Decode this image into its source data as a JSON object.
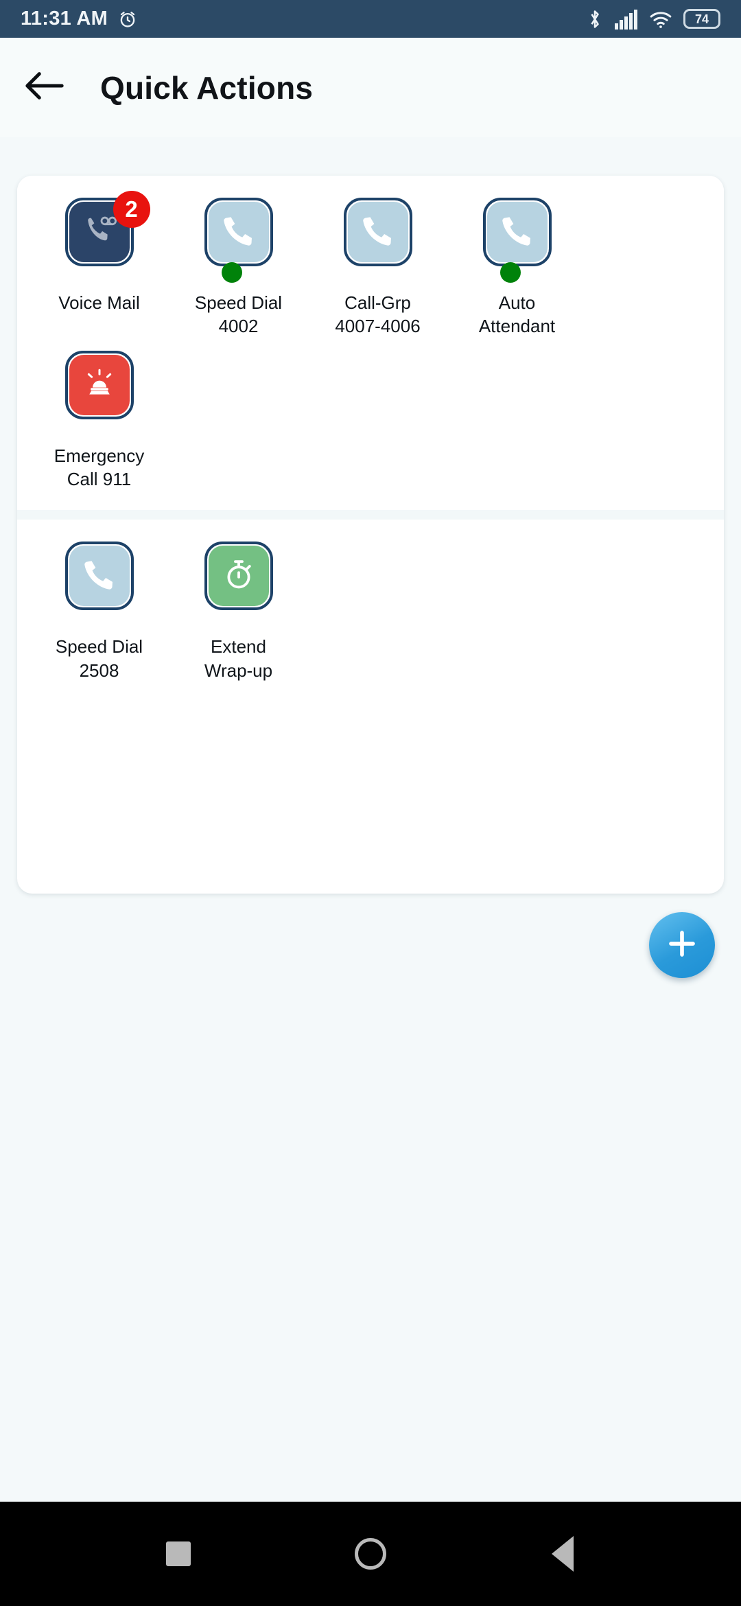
{
  "status_bar": {
    "time": "11:31 AM",
    "alarm_icon": "alarm-clock-icon",
    "bluetooth_icon": "bluetooth-icon",
    "signal_icon": "cellular-signal-icon",
    "wifi_icon": "wifi-icon",
    "battery_level": "74",
    "background_color": "#2c4a66"
  },
  "app_bar": {
    "back_icon": "back-arrow-icon",
    "title": "Quick Actions"
  },
  "sections": [
    {
      "items": [
        {
          "label": "Voice Mail",
          "icon": "voicemail-icon",
          "tile_color": "#2b4468",
          "badge": "2",
          "presence": null
        },
        {
          "label": "Speed Dial\n4002",
          "icon": "phone-icon",
          "tile_color": "#b7d3e1",
          "badge": null,
          "presence": "#00820a"
        },
        {
          "label": "Call-Grp\n4007-4006",
          "icon": "phone-icon",
          "tile_color": "#b7d3e1",
          "badge": null,
          "presence": null
        },
        {
          "label": "Auto\nAttendant",
          "icon": "phone-icon",
          "tile_color": "#b7d3e1",
          "badge": null,
          "presence": "#00820a"
        },
        {
          "label": "Emergency\nCall 911",
          "icon": "emergency-siren-icon",
          "tile_color": "#e8463d",
          "badge": null,
          "presence": null
        }
      ]
    },
    {
      "items": [
        {
          "label": "Speed Dial\n2508",
          "icon": "phone-icon",
          "tile_color": "#b7d3e1",
          "badge": null,
          "presence": null
        },
        {
          "label": "Extend\nWrap-up",
          "icon": "stopwatch-icon",
          "tile_color": "#74c083",
          "badge": null,
          "presence": null
        }
      ]
    }
  ],
  "fab": {
    "icon": "plus-icon",
    "accent_color": "#2a9ada"
  },
  "nav_bar": {
    "recents_icon": "square-recents-icon",
    "home_icon": "circle-home-icon",
    "back_icon": "triangle-back-icon"
  }
}
